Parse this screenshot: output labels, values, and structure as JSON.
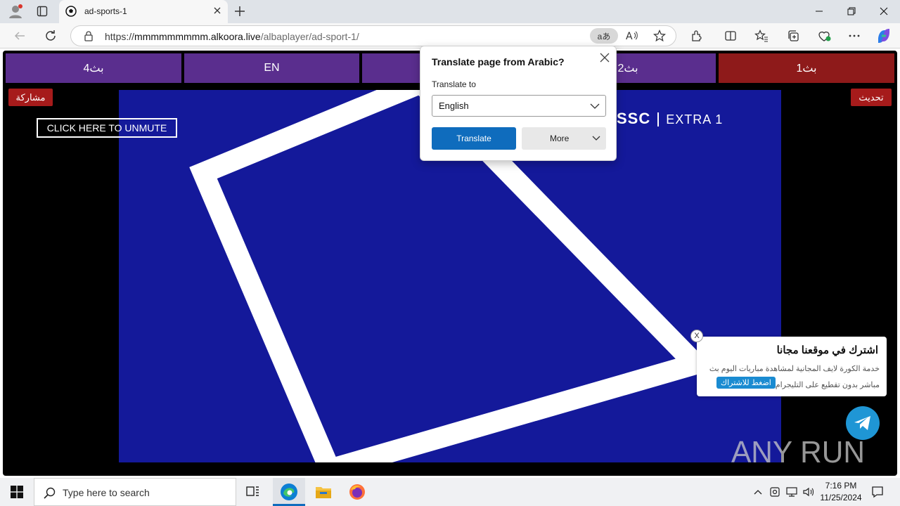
{
  "browser": {
    "tab_title": "ad-sports-1",
    "url_prefix": "https://",
    "url_domain": "mmmmmmmmm.alkoora.live",
    "url_path": "/albaplayer/ad-sport-1/",
    "translate_indicator": "aあ"
  },
  "translate_dialog": {
    "title": "Translate page from Arabic?",
    "label": "Translate to",
    "selected_language": "English",
    "translate_label": "Translate",
    "more_label": "More"
  },
  "page": {
    "nav_buttons": [
      "بث4",
      "EN",
      "",
      "بث2",
      "بث1"
    ],
    "share_label": "مشاركة",
    "refresh_label": "تحديث",
    "unmute_label": "CLICK HERE TO UNMUTE",
    "channel_logo": "SSC",
    "channel_name": "EXTRA 1"
  },
  "promo": {
    "heading": "اشترك في موقعنا مجانا",
    "body": "خدمة الكورة لايف المجانية لمشاهدة مباريات اليوم بث مباشر بدون تقطيع على التليجرام",
    "button_label": "اضغط للاشتراك",
    "close_label": "X"
  },
  "watermark": "ANY RUN",
  "taskbar": {
    "search_placeholder": "Type here to search",
    "time": "7:16 PM",
    "date": "11/25/2024"
  },
  "colors": {
    "nav_purple": "#5a2e8e",
    "nav_active": "#8e1a1a",
    "video_blue": "#14199a",
    "accent_blue": "#0f6cbd",
    "telegram_blue": "#1f96d5"
  }
}
